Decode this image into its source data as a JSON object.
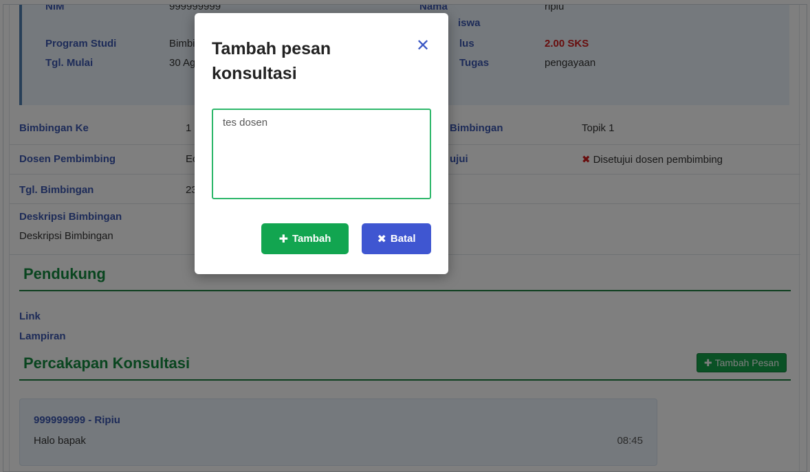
{
  "info": {
    "nim_label": "NIM",
    "nim_value": "999999999",
    "prodi_label": "Program Studi",
    "prodi_value": "Bimbi",
    "mulai_label": "Tgl. Mulai",
    "mulai_value": "30 Agu",
    "nama_label": "Nama",
    "mahasiswa_label": "iswa",
    "nama_value": "ripiu",
    "sks_label": "lus",
    "sks_value": "2.00 SKS",
    "tugas_label": "Tugas",
    "tugas_value": "pengayaan"
  },
  "details": {
    "bimbingan_ke_label": "Bimbingan Ke",
    "bimbingan_ke_value": "1",
    "topik_label": "Bimbingan",
    "topik_value": "Topik 1",
    "dosen_label": "Dosen Pembimbing",
    "dosen_value": "Ec",
    "disetujui_label": "ujui",
    "disetujui_value": "Disetujui dosen pembimbing",
    "tgl_label": "Tgl. Bimbingan",
    "tgl_value": "23",
    "deskripsi_label": "Deskripsi Bimbingan",
    "deskripsi_value": "Deskripsi Bimbingan"
  },
  "pendukung": {
    "title": "Pendukung",
    "link_label": "Link",
    "lampiran_label": "Lampiran"
  },
  "percakapan": {
    "title": "Percakapan Konsultasi",
    "add_button": "Tambah Pesan",
    "messages": [
      {
        "sender": "999999999 - Ripiu",
        "text": "Halo bapak",
        "time": "08:45"
      }
    ]
  },
  "modal": {
    "title": "Tambah pesan konsultasi",
    "close_icon": "close-icon",
    "textarea_value": "tes dosen",
    "tambah_label": "Tambah",
    "batal_label": "Batal"
  },
  "colors": {
    "accent_green": "#12a550",
    "accent_blue": "#3f56d1",
    "label_blue": "#3b57b0",
    "danger_red": "#d11a1a"
  }
}
